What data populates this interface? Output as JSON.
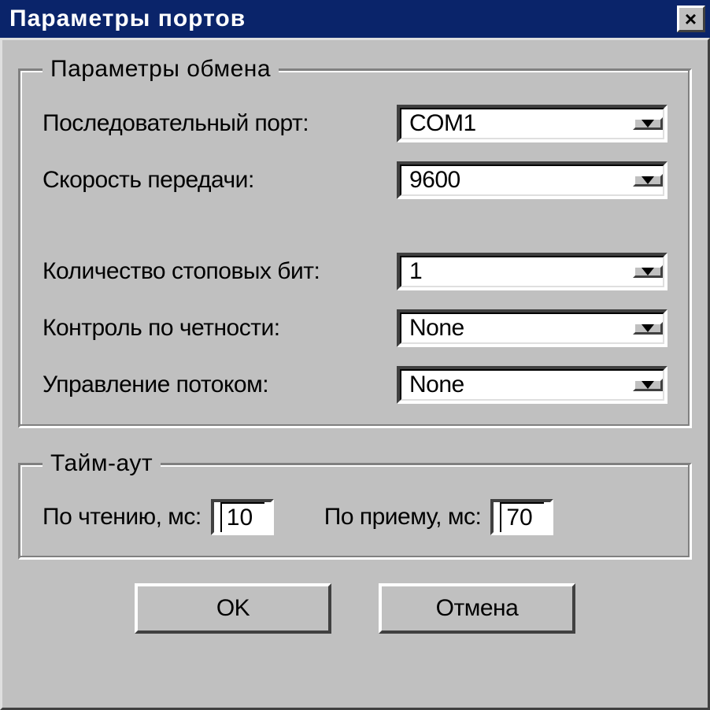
{
  "window": {
    "title": "Параметры портов",
    "close_icon": "close-icon"
  },
  "exchange": {
    "legend": "Параметры обмена",
    "port_label": "Последовательный порт:",
    "port_value": "COM1",
    "baud_label": "Скорость передачи:",
    "baud_value": "9600",
    "stop_label": "Количество стоповых бит:",
    "stop_value": "1",
    "parity_label": "Контроль по четности:",
    "parity_value": "None",
    "flow_label": "Управление потоком:",
    "flow_value": "None"
  },
  "timeout": {
    "legend": "Тайм-аут",
    "read_label": "По чтению, мс:",
    "read_value": "10",
    "recv_label": "По приему, мс:",
    "recv_value": "70"
  },
  "buttons": {
    "ok": "OK",
    "cancel": "Отмена"
  }
}
